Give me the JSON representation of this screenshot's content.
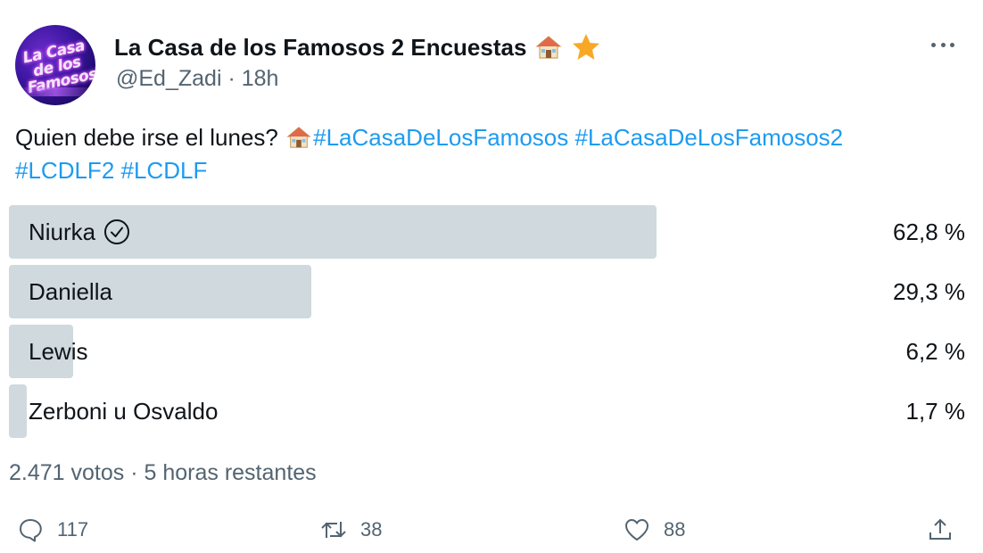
{
  "author": {
    "display_name": "La Casa de los Famosos 2 Encuestas",
    "handle": "@Ed_Zadi",
    "separator": "·",
    "time": "18h",
    "avatar_logo_text": "La Casa de los Famosos"
  },
  "tweet": {
    "text_prefix": "Quien debe irse el lunes?",
    "hashtags": [
      "#LaCasaDeLosFamosos",
      "#LaCasaDeLosFamosos2",
      "#LCDLF2",
      "#LCDLF"
    ]
  },
  "poll": {
    "options": [
      {
        "label": "Niurka",
        "percent_text": "62,8 %",
        "fraction": 0.628,
        "winner": true
      },
      {
        "label": "Daniella",
        "percent_text": "29,3 %",
        "fraction": 0.293,
        "winner": false
      },
      {
        "label": "Lewis",
        "percent_text": "6,2 %",
        "fraction": 0.062,
        "winner": false
      },
      {
        "label": "Zerboni u Osvaldo",
        "percent_text": "1,7 %",
        "fraction": 0.017,
        "winner": false
      }
    ],
    "votes": "2.471 votos",
    "separator": "·",
    "time_left": "5 horas restantes"
  },
  "actions": {
    "reply_count": "117",
    "retweet_count": "38",
    "like_count": "88"
  },
  "icons": [
    "house-emoji-icon",
    "star-emoji-icon",
    "more-icon",
    "check-circle-icon",
    "reply-icon",
    "retweet-icon",
    "like-icon",
    "share-icon"
  ],
  "colors": {
    "link": "#1d9bf0",
    "bar": "#cfd9de",
    "secondary_text": "#536471",
    "star": "#f9a825"
  }
}
